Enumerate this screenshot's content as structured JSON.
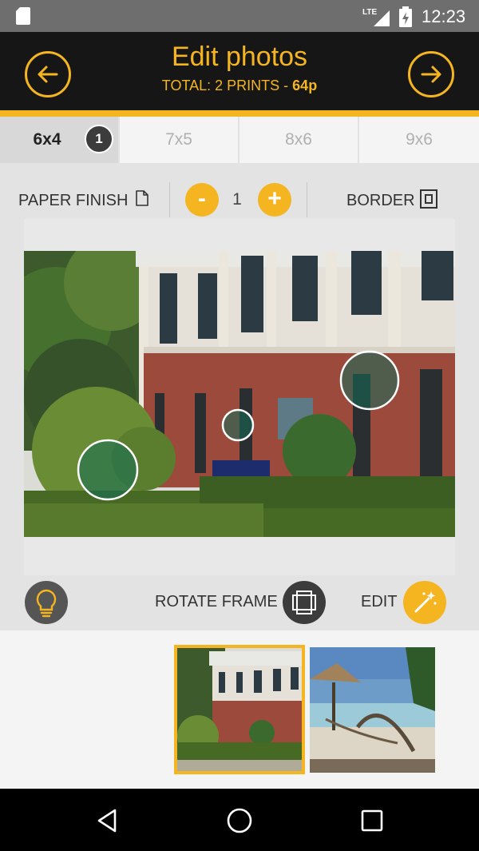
{
  "colors": {
    "accent": "#f4b521",
    "header_bg": "#161616",
    "active_tab_bg": "#d8d8d8"
  },
  "status_bar": {
    "time": "12:23",
    "network": "LTE",
    "icons": [
      "sd-card-icon",
      "lte-signal-icon",
      "battery-charging-icon"
    ]
  },
  "header": {
    "title": "Edit photos",
    "subtitle_prefix": "TOTAL: 2 PRINTS - ",
    "subtitle_price": "64p",
    "back_icon": "arrow-left-circle-icon",
    "next_icon": "arrow-right-circle-icon"
  },
  "size_tabs": [
    {
      "label": "6x4",
      "count": "1",
      "active": true
    },
    {
      "label": "7x5",
      "active": false
    },
    {
      "label": "8x6",
      "active": false
    },
    {
      "label": "9x6",
      "active": false
    }
  ],
  "options": {
    "paper_finish": "PAPER FINISH",
    "paper_icon": "document-icon",
    "minus": "-",
    "quantity": "1",
    "plus": "+",
    "border": "BORDER",
    "border_icon": "border-frame-icon"
  },
  "tools": {
    "tip_icon": "lightbulb-icon",
    "rotate_frame": "ROTATE FRAME",
    "rotate_icon": "rotate-frame-icon",
    "edit": "EDIT",
    "edit_icon": "magic-wand-icon"
  },
  "photo": {
    "subject": "building-photo",
    "overlay_markers": 3
  },
  "thumbnails": [
    {
      "name": "building-photo",
      "selected": true
    },
    {
      "name": "beach-photo",
      "selected": false
    }
  ],
  "navbar": {
    "icons": [
      "back-triangle-icon",
      "home-circle-icon",
      "recents-square-icon"
    ]
  }
}
